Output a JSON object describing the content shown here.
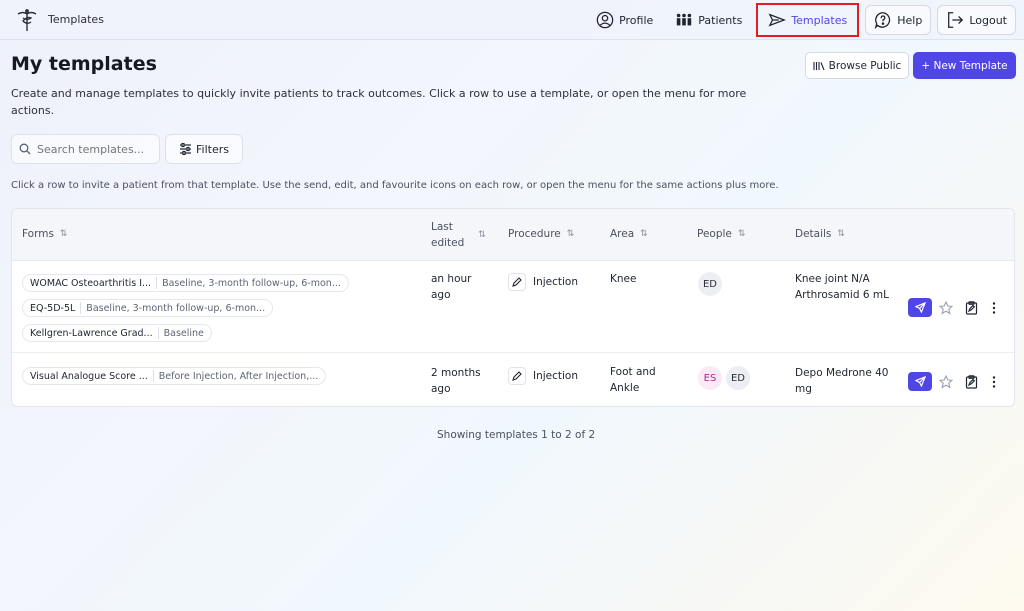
{
  "nav": {
    "brand": "Templates",
    "items": [
      {
        "label": "Profile",
        "icon": "user-circle-icon"
      },
      {
        "label": "Patients",
        "icon": "people-icon"
      },
      {
        "label": "Templates",
        "icon": "send-icon"
      },
      {
        "label": "Help",
        "icon": "help-bubble-icon"
      },
      {
        "label": "Logout",
        "icon": "logout-icon"
      }
    ]
  },
  "page": {
    "title": "My templates",
    "subtitle": "Create and manage templates to quickly invite patients to track outcomes. Click a row to use a template, or open the menu for more actions.",
    "browse_label": "Browse Public",
    "new_label": "+ New Template",
    "search_placeholder": "Search templates...",
    "filters_label": "Filters",
    "hint": "Click a row to invite a patient from that template. Use the send, edit, and favourite icons on each row, or open the menu for the same actions plus more."
  },
  "table": {
    "headers": {
      "forms": "Forms",
      "last_edited_1": "Last",
      "last_edited_2": "edited",
      "procedure": "Procedure",
      "area": "Area",
      "people": "People",
      "details": "Details",
      "sort_glyph": "⇅"
    },
    "rows": [
      {
        "forms": [
          {
            "name": "WOMAC Osteoarthritis I...",
            "timepoints": "Baseline, 3-month follow-up, 6-mon..."
          },
          {
            "name": "EQ-5D-5L",
            "timepoints": "Baseline, 3-month follow-up, 6-mon..."
          },
          {
            "name": "Kellgren-Lawrence Grad...",
            "timepoints": "Baseline"
          }
        ],
        "edited_1": "an hour",
        "edited_2": "ago",
        "procedure": "Injection",
        "area_1": "Knee",
        "area_2": "",
        "people": [
          "ED"
        ],
        "details_1": "Knee joint N/A",
        "details_2": "Arthrosamid 6 mL"
      },
      {
        "forms": [
          {
            "name": "Visual Analogue Score ...",
            "timepoints": "Before Injection, After Injection,..."
          }
        ],
        "edited_1": "2 months",
        "edited_2": "ago",
        "procedure": "Injection",
        "area_1": "Foot and",
        "area_2": "Ankle",
        "people": [
          "ES",
          "ED"
        ],
        "details_1": "Depo Medrone 40",
        "details_2": "mg"
      }
    ]
  },
  "footer": {
    "showing": "Showing templates 1 to 2 of 2"
  },
  "colors": {
    "accent": "#5046e5",
    "highlight_box": "#e11d2a"
  }
}
